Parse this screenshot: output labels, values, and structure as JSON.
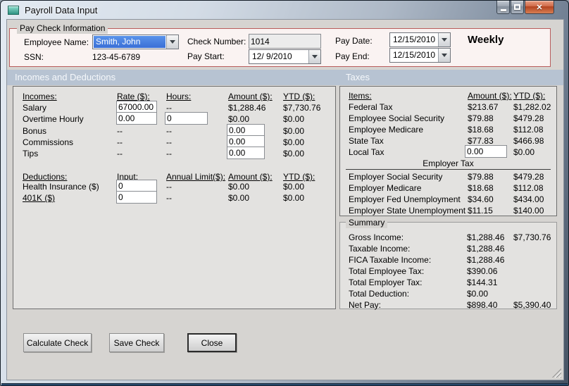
{
  "window": {
    "title": "Payroll Data Input"
  },
  "titlebar": {
    "close_glyph": "✕"
  },
  "paycheck": {
    "group_title": "Pay Check Information",
    "employee_name": {
      "label": "Employee Name:",
      "value": "Smith, John"
    },
    "ssn": {
      "label": "SSN:",
      "value": "123-45-6789"
    },
    "check_number": {
      "label": "Check Number:",
      "value": "1014"
    },
    "pay_start": {
      "label": "Pay Start:",
      "value": "12/ 9/2010"
    },
    "pay_date": {
      "label": "Pay Date:",
      "value": "12/15/2010"
    },
    "pay_end": {
      "label": "Pay End:",
      "value": "12/15/2010"
    },
    "frequency": "Weekly"
  },
  "band": {
    "left": "Incomes and Deductions",
    "right": "Taxes"
  },
  "incomes": {
    "headers": {
      "item": "Incomes:",
      "rate": "Rate ($):",
      "hours": "Hours:",
      "amount": "Amount ($):",
      "ytd": "YTD ($):"
    },
    "rows": [
      {
        "label": "Salary",
        "rate": "67000.00",
        "hours": "--",
        "amount": "$1,288.46",
        "ytd": "$7,730.76"
      },
      {
        "label": "Overtime Hourly",
        "rate": "0.00",
        "hours": "0",
        "amount": "$0.00",
        "ytd": "$0.00"
      },
      {
        "label": "Bonus",
        "rate": "--",
        "hours": "--",
        "amount": "0.00",
        "ytd": "$0.00"
      },
      {
        "label": "Commissions",
        "rate": "--",
        "hours": "--",
        "amount": "0.00",
        "ytd": "$0.00"
      },
      {
        "label": "Tips",
        "rate": "--",
        "hours": "--",
        "amount": "0.00",
        "ytd": "$0.00"
      }
    ]
  },
  "deductions": {
    "headers": {
      "item": "Deductions:",
      "input": "Input:",
      "limit": "Annual Limit($):",
      "amount": "Amount ($):",
      "ytd": "YTD ($):"
    },
    "rows": [
      {
        "label": "Health Insurance ($)",
        "input": "0",
        "limit": "--",
        "amount": "$0.00",
        "ytd": "$0.00"
      },
      {
        "label": "401K ($)",
        "input": "0",
        "limit": "--",
        "amount": "$0.00",
        "ytd": "$0.00"
      }
    ]
  },
  "taxes": {
    "headers": {
      "item": "Items:",
      "amount": "Amount ($):",
      "ytd": "YTD ($):"
    },
    "employee_rows": [
      {
        "label": "Federal Tax",
        "amount": "$213.67",
        "ytd": "$1,282.02"
      },
      {
        "label": "Employee Social Security",
        "amount": "$79.88",
        "ytd": "$479.28"
      },
      {
        "label": "Employee Medicare",
        "amount": "$18.68",
        "ytd": "$112.08"
      },
      {
        "label": "State Tax",
        "amount": "$77.83",
        "ytd": "$466.98"
      },
      {
        "label": "Local Tax",
        "amount": "0.00",
        "ytd": "$0.00"
      }
    ],
    "employer_header": "Employer Tax",
    "employer_rows": [
      {
        "label": "Employer Social Security",
        "amount": "$79.88",
        "ytd": "$479.28"
      },
      {
        "label": "Employer Medicare",
        "amount": "$18.68",
        "ytd": "$112.08"
      },
      {
        "label": "Employer Fed Unemployment",
        "amount": "$34.60",
        "ytd": "$434.00"
      },
      {
        "label": "Employer State Unemployment",
        "amount": "$11.15",
        "ytd": "$140.00"
      }
    ]
  },
  "summary": {
    "group_title": "Summary",
    "rows": [
      {
        "label": "Gross Income:",
        "amount": "$1,288.46",
        "ytd": "$7,730.76"
      },
      {
        "label": "Taxable Income:",
        "amount": "$1,288.46",
        "ytd": ""
      },
      {
        "label": "FICA Taxable Income:",
        "amount": "$1,288.46",
        "ytd": ""
      },
      {
        "label": "Total Employee Tax:",
        "amount": "$390.06",
        "ytd": ""
      },
      {
        "label": "Total Employer Tax:",
        "amount": "$144.31",
        "ytd": ""
      },
      {
        "label": "Total Deduction:",
        "amount": "$0.00",
        "ytd": ""
      },
      {
        "label": "Net Pay:",
        "amount": "$898.40",
        "ytd": "$5,390.40"
      }
    ]
  },
  "buttons": {
    "calculate": "Calculate Check",
    "save": "Save Check",
    "close": "Close"
  },
  "colors": {
    "band_bg": "#b7c3d2",
    "paycheck_border": "#b85c5c",
    "selection_blue": "#3a6fd6",
    "close_button_red": "#b2431f",
    "client_bg": "#d6d4d1",
    "panel_bg": "#e3e2e0"
  }
}
